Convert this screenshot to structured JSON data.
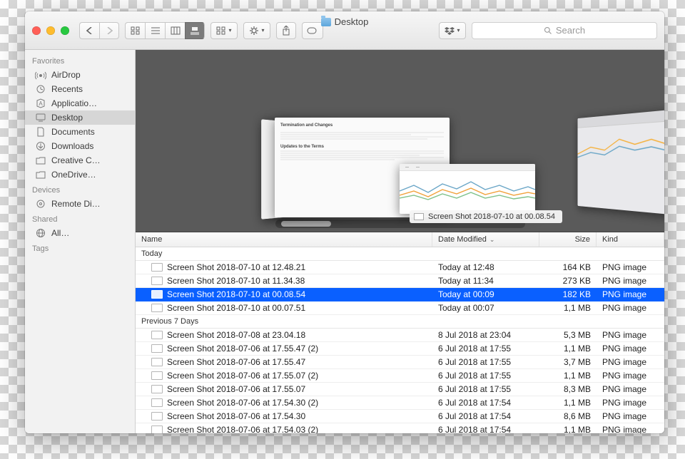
{
  "window_title": "Desktop",
  "search": {
    "placeholder": "Search"
  },
  "sidebar": {
    "groups": [
      {
        "label": "Favorites",
        "items": [
          {
            "icon": "airdrop-icon",
            "label": "AirDrop"
          },
          {
            "icon": "recents-icon",
            "label": "Recents"
          },
          {
            "icon": "applications-icon",
            "label": "Applicatio…"
          },
          {
            "icon": "desktop-icon",
            "label": "Desktop",
            "selected": true
          },
          {
            "icon": "documents-icon",
            "label": "Documents"
          },
          {
            "icon": "downloads-icon",
            "label": "Downloads"
          },
          {
            "icon": "folder-icon",
            "label": "Creative C…"
          },
          {
            "icon": "folder-icon",
            "label": "OneDrive…"
          }
        ]
      },
      {
        "label": "Devices",
        "items": [
          {
            "icon": "remote-disc-icon",
            "label": "Remote Di…"
          }
        ]
      },
      {
        "label": "Shared",
        "items": [
          {
            "icon": "network-icon",
            "label": "All…"
          }
        ]
      },
      {
        "label": "Tags",
        "items": []
      }
    ]
  },
  "coverflow": {
    "center_doc": {
      "h1": "Termination and Changes",
      "h2": "Updates to the Terms"
    },
    "caption": "Screen Shot 2018-07-10 at 00.08.54"
  },
  "columns": {
    "name": "Name",
    "date": "Date Modified",
    "size": "Size",
    "kind": "Kind"
  },
  "sections": [
    {
      "label": "Today",
      "rows": [
        {
          "name": "Screen Shot 2018-07-10 at 12.48.21",
          "date": "Today at 12:48",
          "size": "164 KB",
          "kind": "PNG image"
        },
        {
          "name": "Screen Shot 2018-07-10 at 11.34.38",
          "date": "Today at 11:34",
          "size": "273 KB",
          "kind": "PNG image"
        },
        {
          "name": "Screen Shot 2018-07-10 at 00.08.54",
          "date": "Today at 00:09",
          "size": "182 KB",
          "kind": "PNG image",
          "selected": true
        },
        {
          "name": "Screen Shot 2018-07-10 at 00.07.51",
          "date": "Today at 00:07",
          "size": "1,1 MB",
          "kind": "PNG image"
        }
      ]
    },
    {
      "label": "Previous 7 Days",
      "rows": [
        {
          "name": "Screen Shot 2018-07-08 at 23.04.18",
          "date": "8 Jul 2018 at 23:04",
          "size": "5,3 MB",
          "kind": "PNG image"
        },
        {
          "name": "Screen Shot 2018-07-06 at 17.55.47 (2)",
          "date": "6 Jul 2018 at 17:55",
          "size": "1,1 MB",
          "kind": "PNG image"
        },
        {
          "name": "Screen Shot 2018-07-06 at 17.55.47",
          "date": "6 Jul 2018 at 17:55",
          "size": "3,7 MB",
          "kind": "PNG image"
        },
        {
          "name": "Screen Shot 2018-07-06 at 17.55.07 (2)",
          "date": "6 Jul 2018 at 17:55",
          "size": "1,1 MB",
          "kind": "PNG image"
        },
        {
          "name": "Screen Shot 2018-07-06 at 17.55.07",
          "date": "6 Jul 2018 at 17:55",
          "size": "8,3 MB",
          "kind": "PNG image"
        },
        {
          "name": "Screen Shot 2018-07-06 at 17.54.30 (2)",
          "date": "6 Jul 2018 at 17:54",
          "size": "1,1 MB",
          "kind": "PNG image"
        },
        {
          "name": "Screen Shot 2018-07-06 at 17.54.30",
          "date": "6 Jul 2018 at 17:54",
          "size": "8,6 MB",
          "kind": "PNG image"
        },
        {
          "name": "Screen Shot 2018-07-06 at 17.54.03 (2)",
          "date": "6 Jul 2018 at 17:54",
          "size": "1,1 MB",
          "kind": "PNG image"
        }
      ]
    }
  ]
}
